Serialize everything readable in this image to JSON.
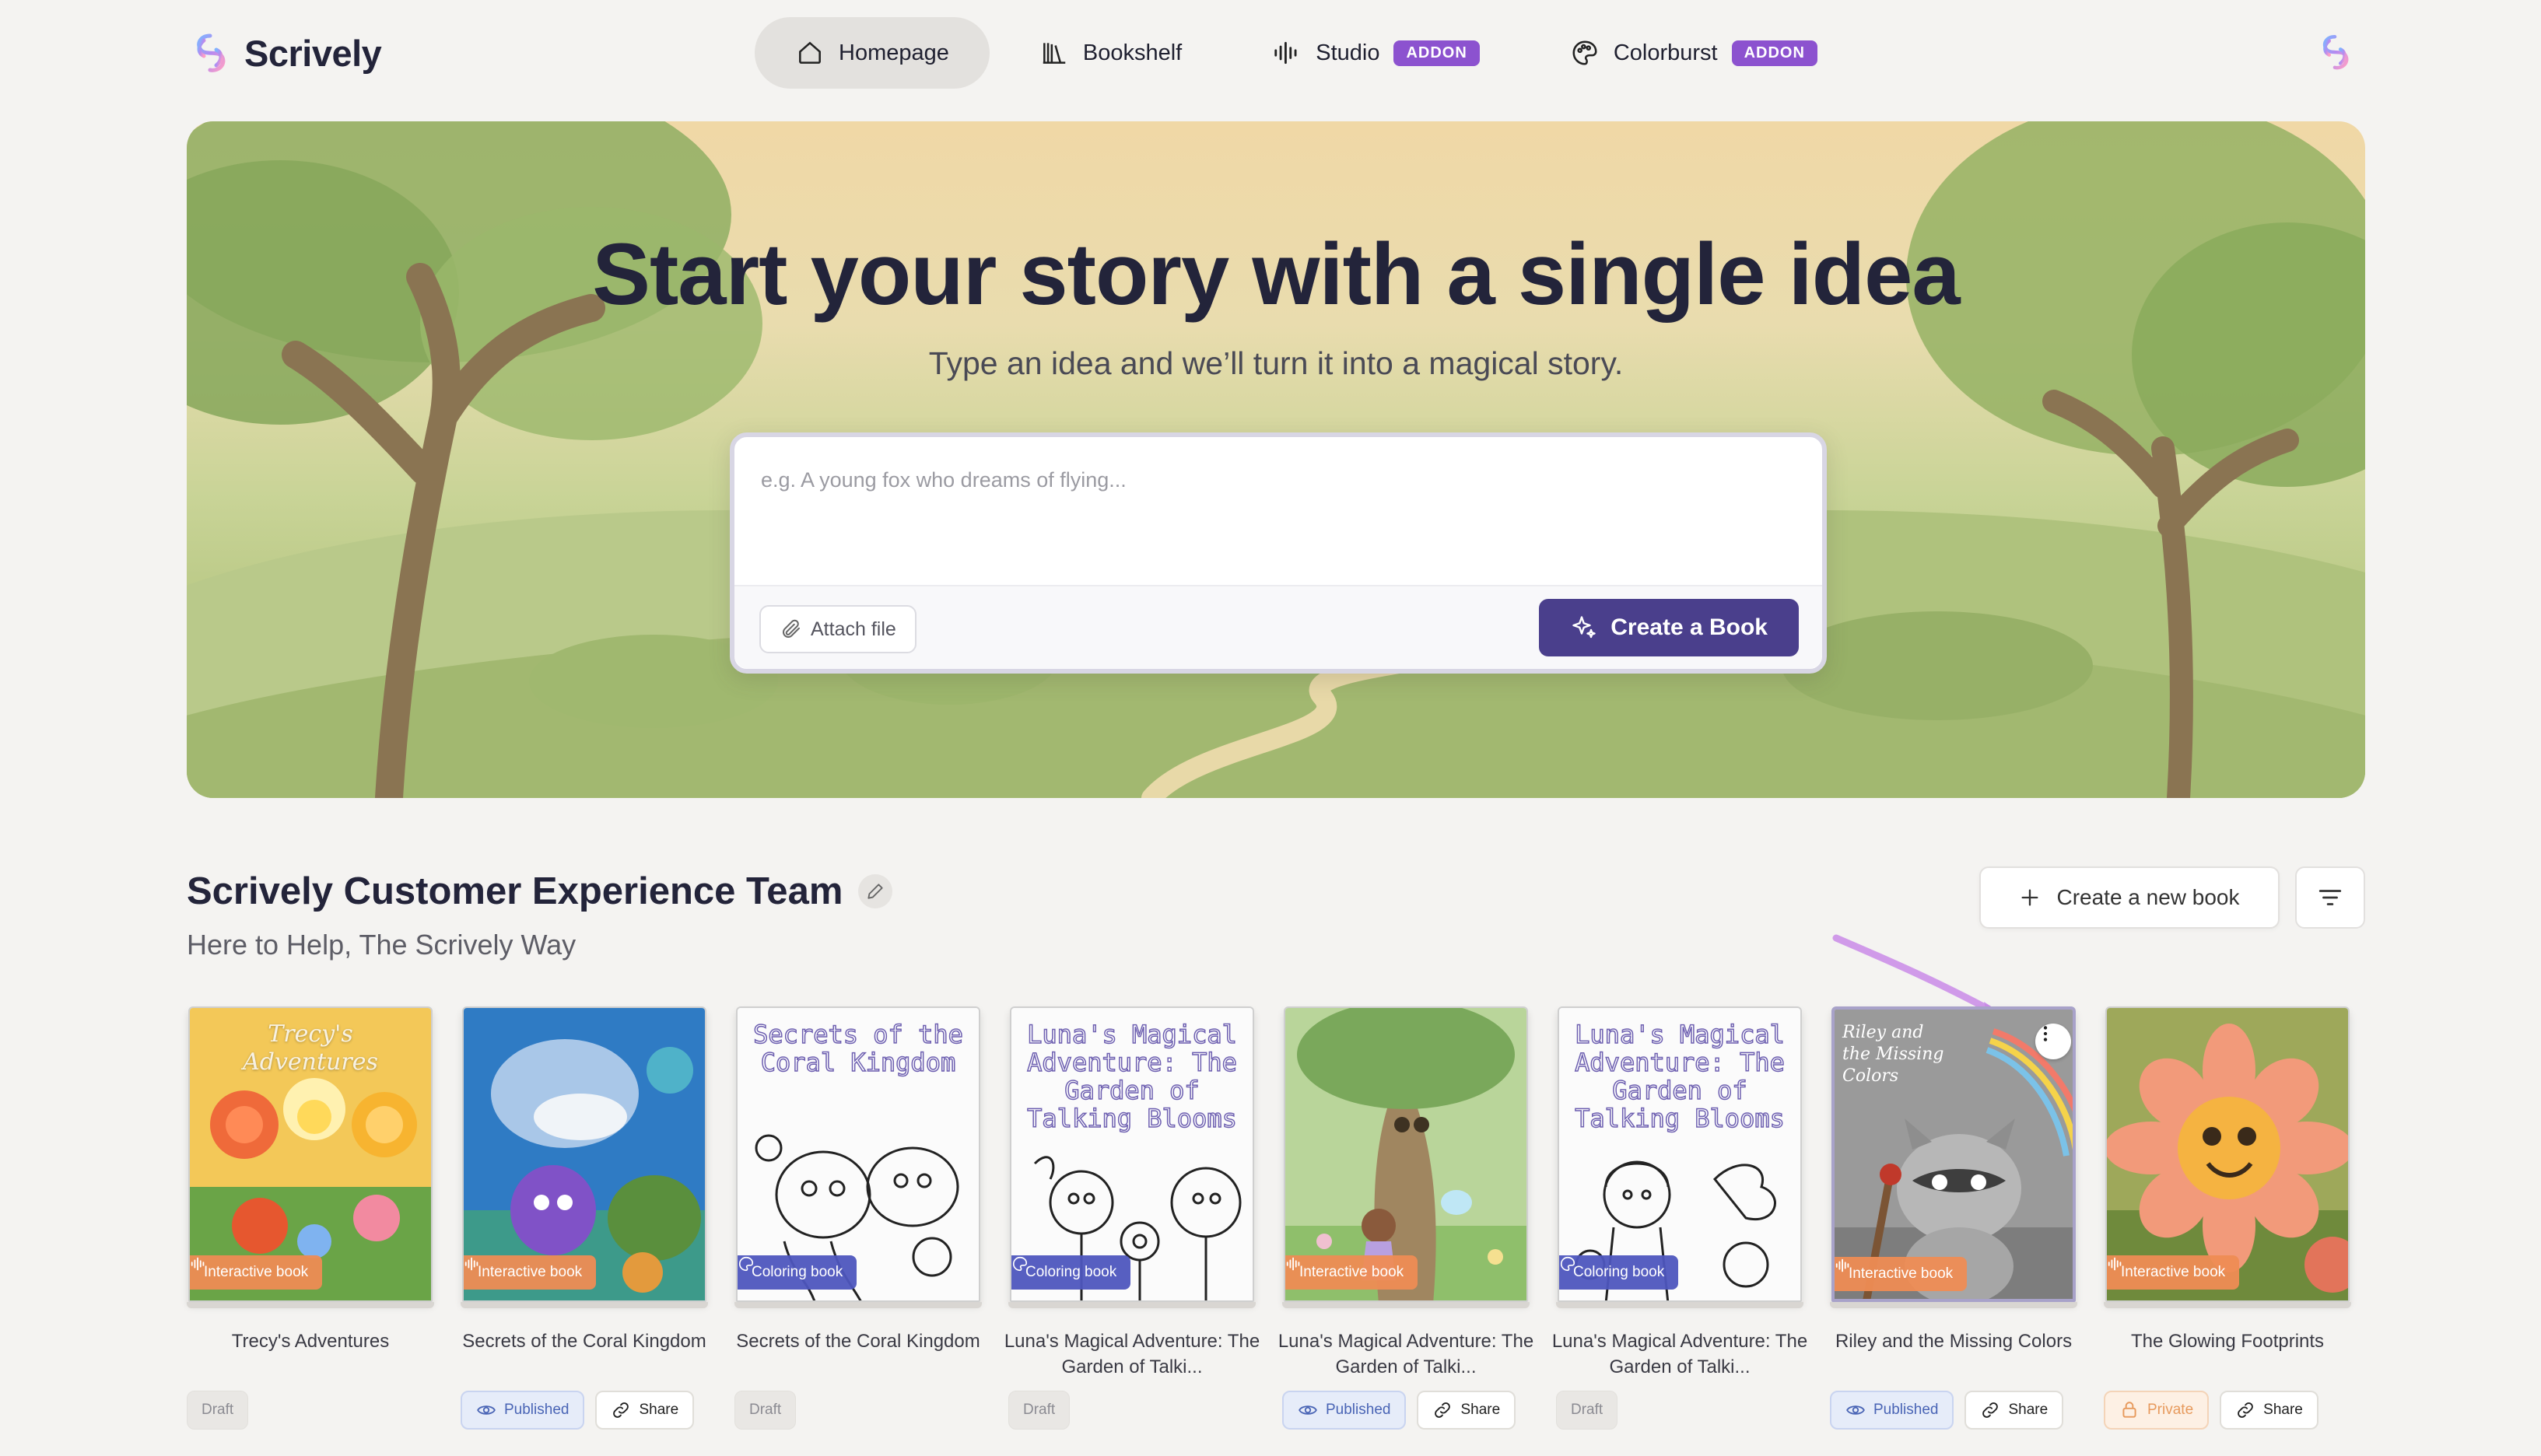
{
  "app": {
    "brand": "Scrively"
  },
  "nav": {
    "items": [
      {
        "label": "Homepage",
        "icon": "home-icon",
        "active": true
      },
      {
        "label": "Bookshelf",
        "icon": "bookshelf-icon"
      },
      {
        "label": "Studio",
        "icon": "audio-wave-icon",
        "badge": "ADDON"
      },
      {
        "label": "Colorburst",
        "icon": "palette-icon",
        "badge": "ADDON"
      }
    ]
  },
  "hero": {
    "title": "Start your story with a single idea",
    "subtitle": "Type an idea and we’ll turn it into a magical story.",
    "prompt_placeholder": "e.g. A young fox who dreams of flying...",
    "prompt_value": "",
    "attach_label": "Attach file",
    "create_label": "Create a Book"
  },
  "team": {
    "title": "Scrively Customer Experience Team",
    "subtitle": "Here to Help, The Scrively Way",
    "new_book_label": "Create a new book"
  },
  "books": [
    {
      "title": "Trecy's Adventures",
      "cover_title": "Trecy's Adventures",
      "type": "Interactive book",
      "status": "Draft"
    },
    {
      "title": "Secrets of the Coral Kingdom",
      "cover_title": "",
      "type": "Interactive book",
      "status": "Published",
      "share": "Share"
    },
    {
      "title": "Secrets of the Coral Kingdom",
      "cover_title": "Secrets of the Coral Kingdom",
      "type": "Coloring book",
      "status": "Draft"
    },
    {
      "title": "Luna's Magical Adventure: The Garden of Talki...",
      "cover_title": "Luna's Magical Adventure: The Garden of Talking Blooms",
      "type": "Coloring book",
      "status": "Draft"
    },
    {
      "title": "Luna's Magical Adventure: The Garden of Talki...",
      "cover_title": "",
      "type": "Interactive book",
      "status": "Published",
      "share": "Share"
    },
    {
      "title": "Luna's Magical Adventure: The Garden of Talki...",
      "cover_title": "Luna's Magical Adventure: The Garden of Talking Blooms",
      "type": "Coloring book",
      "status": "Draft"
    },
    {
      "title": "Riley and the Missing Colors",
      "cover_title": "Riley and the Missing Colors",
      "type": "Interactive book",
      "status": "Published",
      "share": "Share"
    },
    {
      "title": "The Glowing Footprints",
      "cover_title": "",
      "type": "Interactive book",
      "status": "Private",
      "share": "Share"
    }
  ],
  "colors": {
    "accent": "#4a3f8c",
    "addon_badge": "#8c52cf",
    "interactive_badge": "#ee8c54",
    "coloring_badge": "#4e56be",
    "annotation_arrow": "#c98ae8"
  }
}
